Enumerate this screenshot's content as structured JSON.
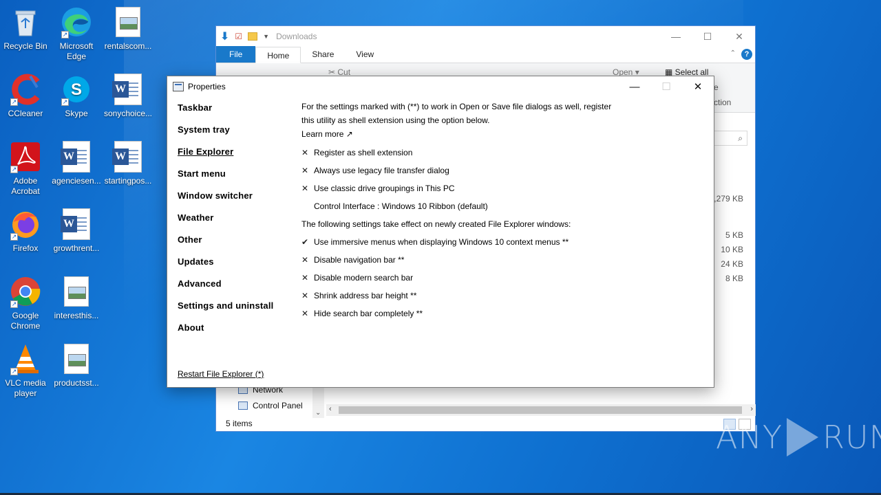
{
  "desktop": {
    "icons": [
      {
        "label": "Recycle Bin"
      },
      {
        "label": "Microsoft Edge"
      },
      {
        "label": "rentalscom..."
      },
      {
        "label": "CCleaner"
      },
      {
        "label": "Skype"
      },
      {
        "label": "sonychoice..."
      },
      {
        "label": "Adobe Acrobat"
      },
      {
        "label": "agenciesen..."
      },
      {
        "label": "startingpos..."
      },
      {
        "label": "Firefox"
      },
      {
        "label": "growthrent..."
      },
      {
        "label": "Google Chrome"
      },
      {
        "label": "interesthis..."
      },
      {
        "label": "VLC media player"
      },
      {
        "label": "productsst..."
      }
    ]
  },
  "explorer": {
    "title": "Downloads",
    "tabs": {
      "file": "File",
      "home": "Home",
      "share": "Share",
      "view": "View"
    },
    "ribbon": {
      "cut": "Cut",
      "open": "Open",
      "select_all": "Select all",
      "frag1": "e",
      "frag2": "ction"
    },
    "sizes": [
      "0,279 KB",
      "5 KB",
      "10 KB",
      "24 KB",
      "8 KB"
    ],
    "nav": {
      "network": "Network",
      "control_panel": "Control Panel"
    },
    "status": "5 items"
  },
  "dialog": {
    "title": "Properties",
    "nav": [
      {
        "label": "Taskbar"
      },
      {
        "label": "System tray"
      },
      {
        "label": "File Explorer"
      },
      {
        "label": "Start menu"
      },
      {
        "label": "Window switcher"
      },
      {
        "label": "Weather"
      },
      {
        "label": "Other"
      },
      {
        "label": "Updates"
      },
      {
        "label": "Advanced"
      },
      {
        "label": "Settings and uninstall"
      },
      {
        "label": "About"
      }
    ],
    "intro_line1": "For the settings marked with (**) to work in Open or Save file dialogs as well, register",
    "intro_line2": "this utility as shell extension using the option below.",
    "learn_more": "Learn more ↗",
    "options_a": [
      {
        "mark": "✕",
        "label": "Register as shell extension"
      },
      {
        "mark": "✕",
        "label": "Always use legacy file transfer dialog"
      },
      {
        "mark": "✕",
        "label": "Use classic drive groupings in This PC"
      }
    ],
    "control_interface": "Control Interface : Windows 10 Ribbon (default)",
    "section_label": "The following settings take effect on newly created File Explorer windows:",
    "options_b": [
      {
        "mark": "✔",
        "label": "Use immersive menus when displaying Windows 10 context menus **"
      },
      {
        "mark": "✕",
        "label": "Disable navigation bar **"
      },
      {
        "mark": "✕",
        "label": "Disable modern search bar"
      },
      {
        "mark": "✕",
        "label": "Shrink address bar height **"
      },
      {
        "mark": "✕",
        "label": "Hide search bar completely **"
      }
    ],
    "restart": "Restart File Explorer (*)"
  },
  "watermark": {
    "left": "ANY",
    "right": "RUN"
  }
}
